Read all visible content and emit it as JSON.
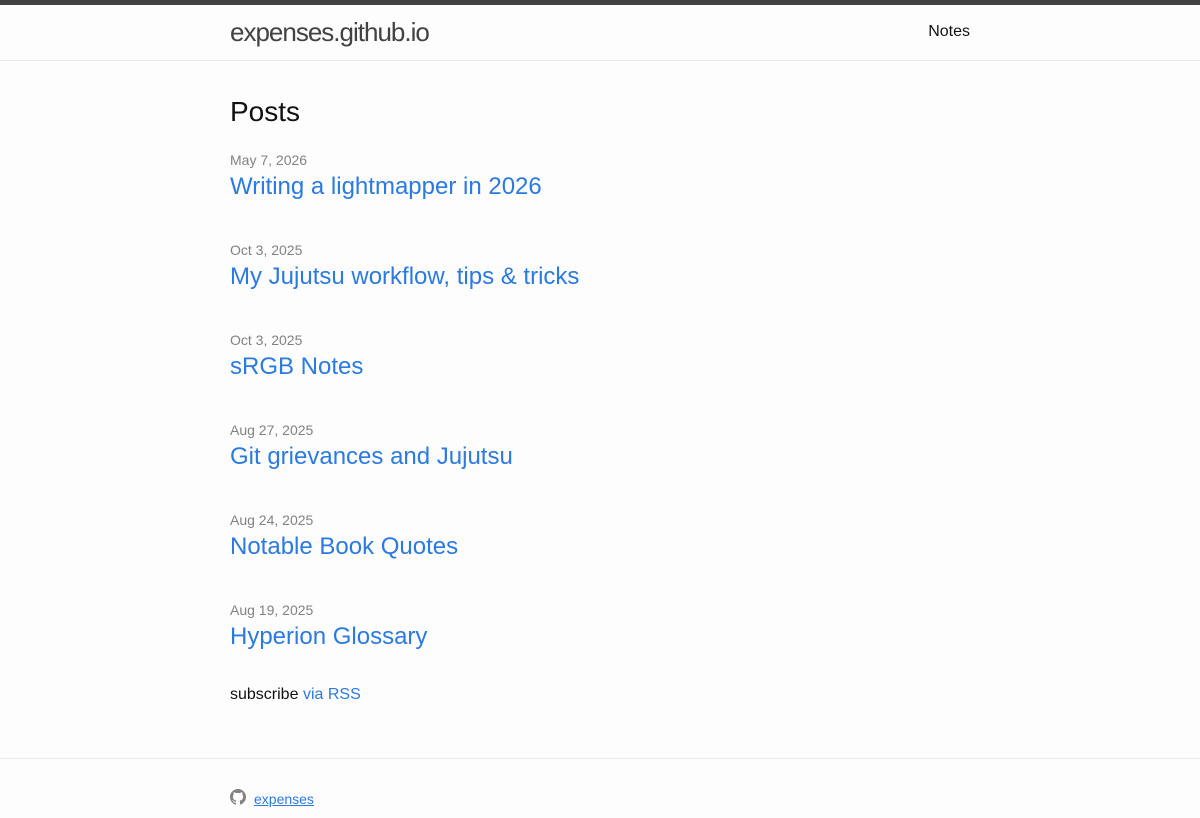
{
  "header": {
    "site_title": "expenses.github.io",
    "nav": [
      {
        "label": "Notes"
      }
    ]
  },
  "main": {
    "heading": "Posts",
    "posts": [
      {
        "date": "May 7, 2026",
        "title": "Writing a lightmapper in 2026"
      },
      {
        "date": "Oct 3, 2025",
        "title": "My Jujutsu workflow, tips & tricks"
      },
      {
        "date": "Oct 3, 2025",
        "title": "sRGB Notes"
      },
      {
        "date": "Aug 27, 2025",
        "title": "Git grievances and Jujutsu"
      },
      {
        "date": "Aug 24, 2025",
        "title": "Notable Book Quotes"
      },
      {
        "date": "Aug 19, 2025",
        "title": "Hyperion Glossary"
      }
    ],
    "rss": {
      "prefix": "subscribe",
      "link_label": "via RSS"
    }
  },
  "footer": {
    "github_icon": "github-icon",
    "github_label": "expenses"
  },
  "colors": {
    "link": "#2a7ae2",
    "meta": "#828282",
    "topbar": "#424242"
  }
}
